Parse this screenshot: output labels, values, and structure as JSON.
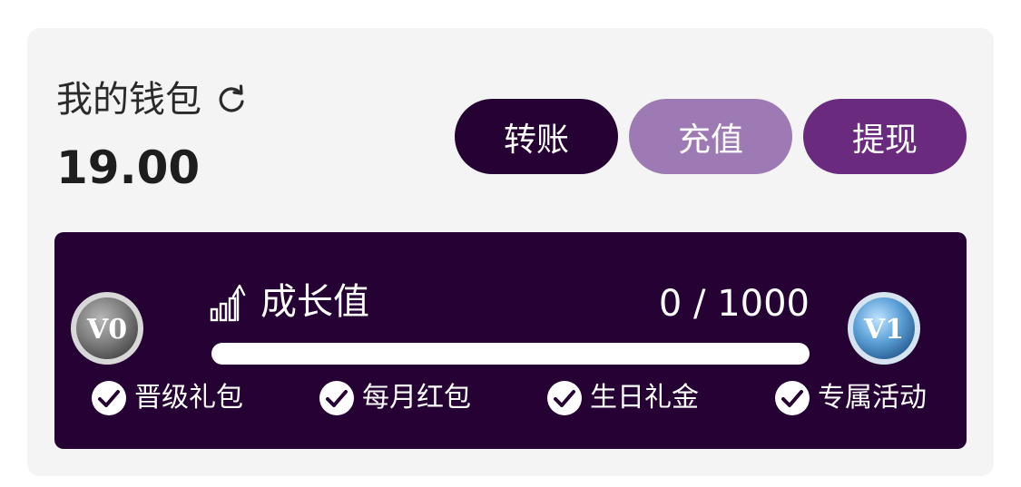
{
  "wallet": {
    "title": "我的钱包",
    "refresh_icon": "refresh-icon",
    "balance": "19.00"
  },
  "actions": {
    "transfer_label": "转账",
    "recharge_label": "充值",
    "withdraw_label": "提现"
  },
  "growth": {
    "title": "成长值",
    "icon": "growth-chart-icon",
    "value_text": "0 / 1000",
    "current": 0,
    "max": 1000,
    "current_level": "V0",
    "next_level": "V1",
    "perks": [
      "晋级礼包",
      "每月红包",
      "生日礼金",
      "专属活动"
    ]
  },
  "colors": {
    "transfer": "#250233",
    "recharge": "#9d7ab3",
    "withdraw": "#6a2a7e",
    "panel": "#250233",
    "card": "#f4f4f5"
  }
}
